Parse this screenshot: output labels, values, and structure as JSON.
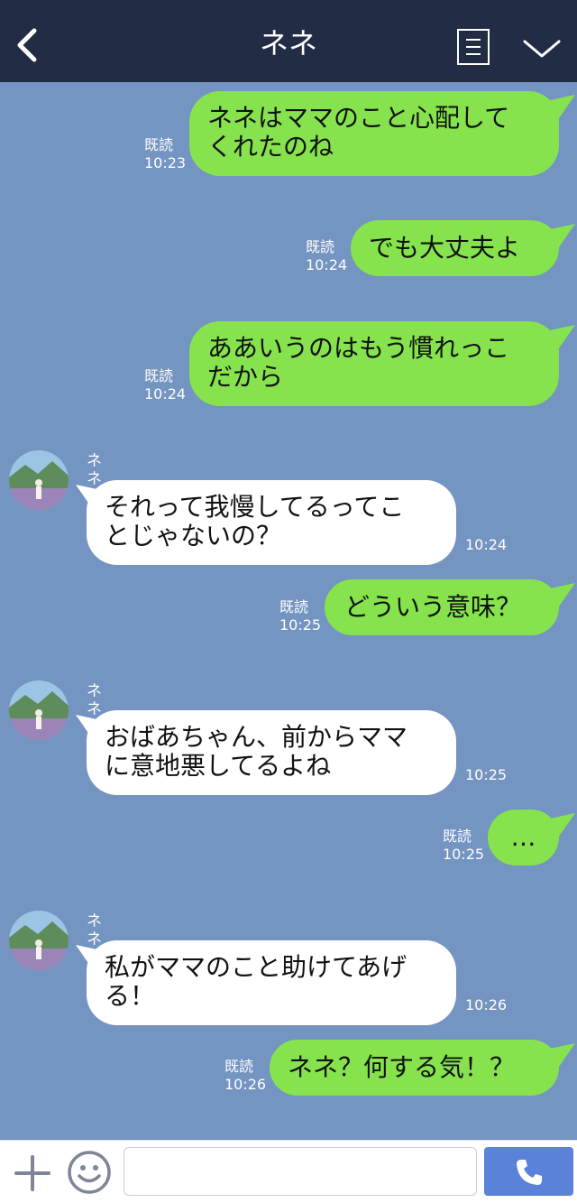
{
  "header": {
    "title": "ネネ"
  },
  "messages": [
    {
      "dir": "out",
      "text": "ネネはママのこと心配して\nくれたのね",
      "read": "既読",
      "time": "10:23"
    },
    {
      "dir": "out",
      "text": "でも大丈夫よ",
      "read": "既読",
      "time": "10:24"
    },
    {
      "dir": "out",
      "text": "ああいうのはもう慣れっこ\nだから",
      "read": "既読",
      "time": "10:24"
    },
    {
      "dir": "in",
      "sender": "ネネ",
      "text": "それって我慢してるってこ\nとじゃないの？",
      "time": "10:24"
    },
    {
      "dir": "out",
      "text": "どういう意味？",
      "read": "既読",
      "time": "10:25"
    },
    {
      "dir": "in",
      "sender": "ネネ",
      "text": "おばあちゃん、前からママ\nに意地悪してるよね",
      "time": "10:25"
    },
    {
      "dir": "out",
      "text": "…",
      "read": "既読",
      "time": "10:25"
    },
    {
      "dir": "in",
      "sender": "ネネ",
      "text": "私がママのこと助けてあげ\nる！",
      "time": "10:26"
    },
    {
      "dir": "out",
      "text": "ネネ？何する気！？",
      "read": "既読",
      "time": "10:26"
    }
  ],
  "footer": {
    "input_value": ""
  },
  "colors": {
    "header_bg": "#232c45",
    "chat_bg": "#7494c1",
    "out_bubble": "#86e34d",
    "in_bubble": "#ffffff",
    "call_button": "#5a82d8"
  },
  "icons": [
    "back-icon",
    "menu-icon",
    "chevron-down-icon",
    "plus-icon",
    "emoji-icon",
    "phone-icon"
  ]
}
